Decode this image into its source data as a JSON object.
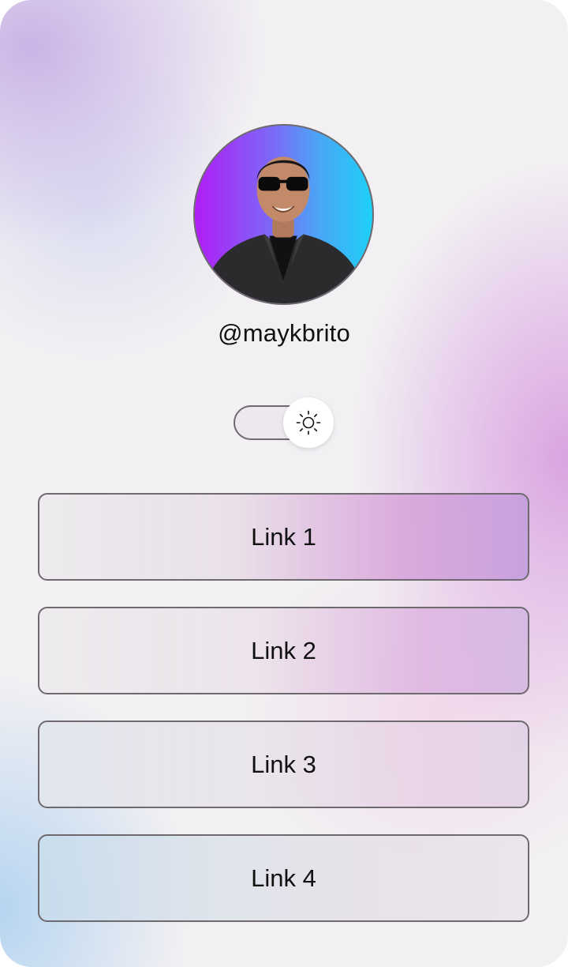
{
  "profile": {
    "username": "@maykbrito",
    "avatar_icon": "profile-photo",
    "avatar_gradient": [
      "#b11cf6",
      "#1ed0f8"
    ]
  },
  "theme_toggle": {
    "icon": "sun-icon",
    "state": "light"
  },
  "links": [
    {
      "label": "Link 1"
    },
    {
      "label": "Link 2"
    },
    {
      "label": "Link 3"
    },
    {
      "label": "Link 4"
    }
  ],
  "colors": {
    "border": "#6e6a70",
    "text": "#111111",
    "accent_purple": "#d6a0de",
    "accent_blue": "#b0d2f0"
  }
}
